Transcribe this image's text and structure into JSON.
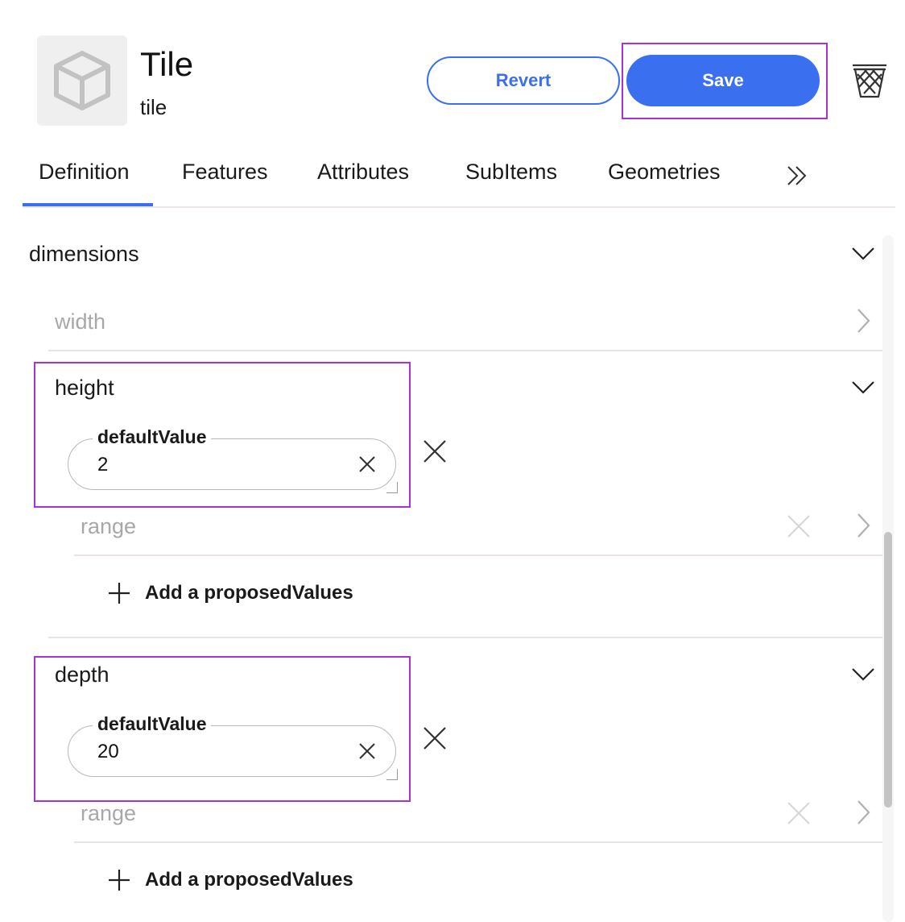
{
  "header": {
    "title": "Tile",
    "subtitle": "tile",
    "revert_label": "Revert",
    "save_label": "Save",
    "thumbnail_icon": "cube-icon",
    "delete_icon": "trash-icon"
  },
  "tabs": [
    {
      "label": "Definition",
      "active": true
    },
    {
      "label": "Features"
    },
    {
      "label": "Attributes"
    },
    {
      "label": "SubItems"
    },
    {
      "label": "Geometries"
    }
  ],
  "more_tabs_icon": "double-chevron-right-icon",
  "section": {
    "title": "dimensions",
    "expanded": true,
    "properties": [
      {
        "name": "width",
        "expanded": false
      },
      {
        "name": "height",
        "expanded": true,
        "default_value": {
          "label": "defaultValue",
          "value": "2"
        },
        "range_label": "range",
        "add_label": "Add a proposedValues"
      },
      {
        "name": "depth",
        "expanded": true,
        "default_value": {
          "label": "defaultValue",
          "value": "20"
        },
        "range_label": "range",
        "add_label": "Add a proposedValues"
      }
    ]
  },
  "colors": {
    "accent": "#3a6ff0",
    "highlight": "#a832d8",
    "muted_text": "#a8a8a8"
  }
}
